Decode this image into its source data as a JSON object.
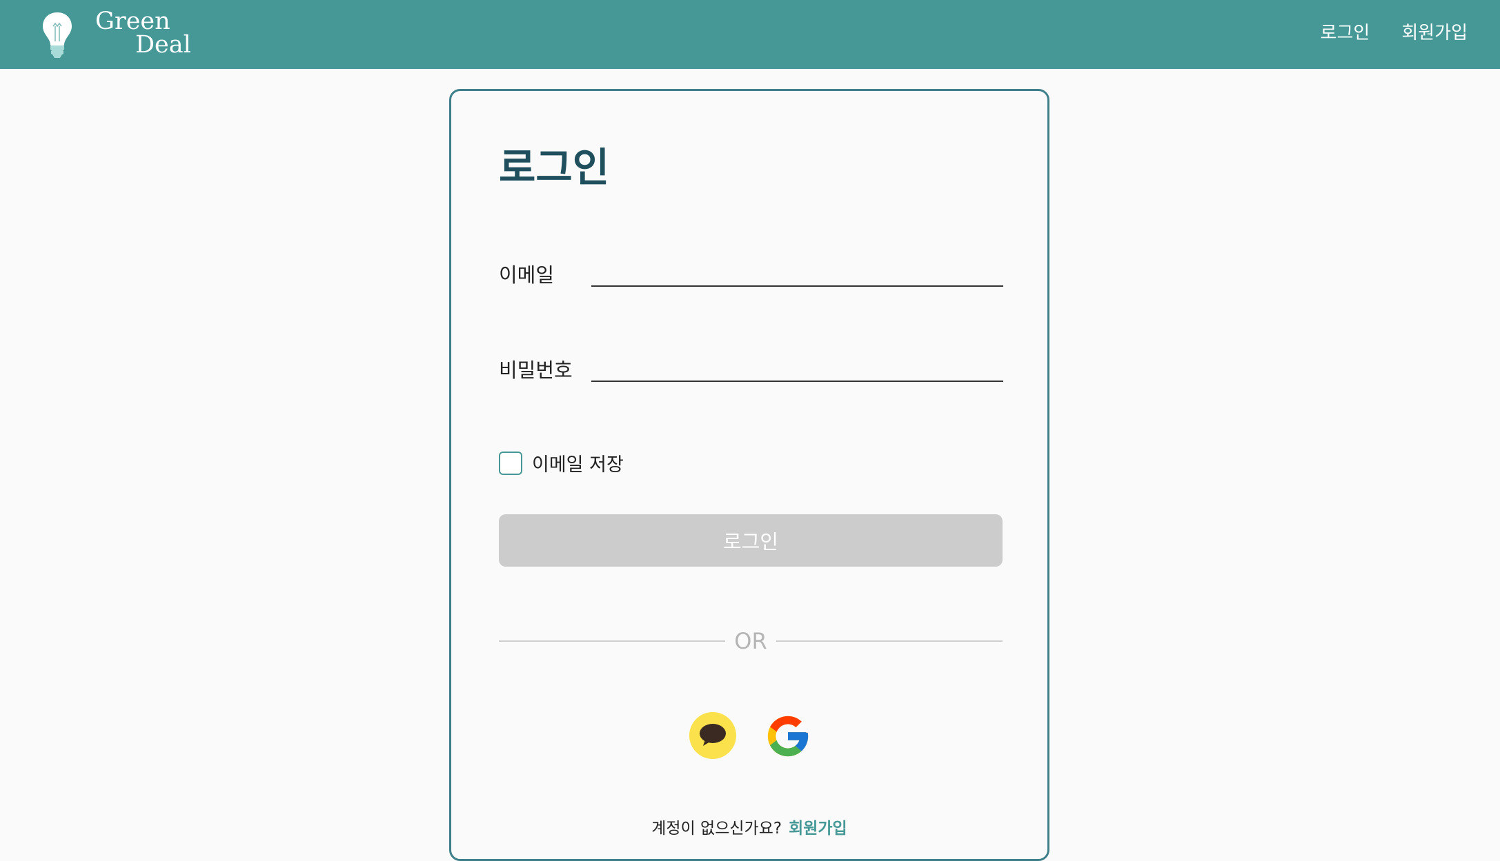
{
  "header": {
    "logo": {
      "line1": "Green",
      "line2": "Deal",
      "icon": "lightbulb-icon"
    },
    "nav": [
      {
        "label": "로그인"
      },
      {
        "label": "회원가입"
      }
    ],
    "colors": {
      "bar": "#459896",
      "text": "#ffffff"
    }
  },
  "login": {
    "title": "로그인",
    "email_label": "이메일",
    "email_value": "",
    "password_label": "비밀번호",
    "password_value": "",
    "remember_label": "이메일 저장",
    "remember_checked": false,
    "submit_label": "로그인",
    "divider_text": "OR",
    "social": [
      {
        "icon": "kakao-icon"
      },
      {
        "icon": "google-icon"
      }
    ],
    "signup_prompt": "계정이 없으신가요?",
    "signup_link": "회원가입",
    "colors": {
      "title": "#1f4f5d",
      "accent": "#459896",
      "button_disabled": "#cccccc",
      "kakao": "#fbe14b"
    }
  }
}
